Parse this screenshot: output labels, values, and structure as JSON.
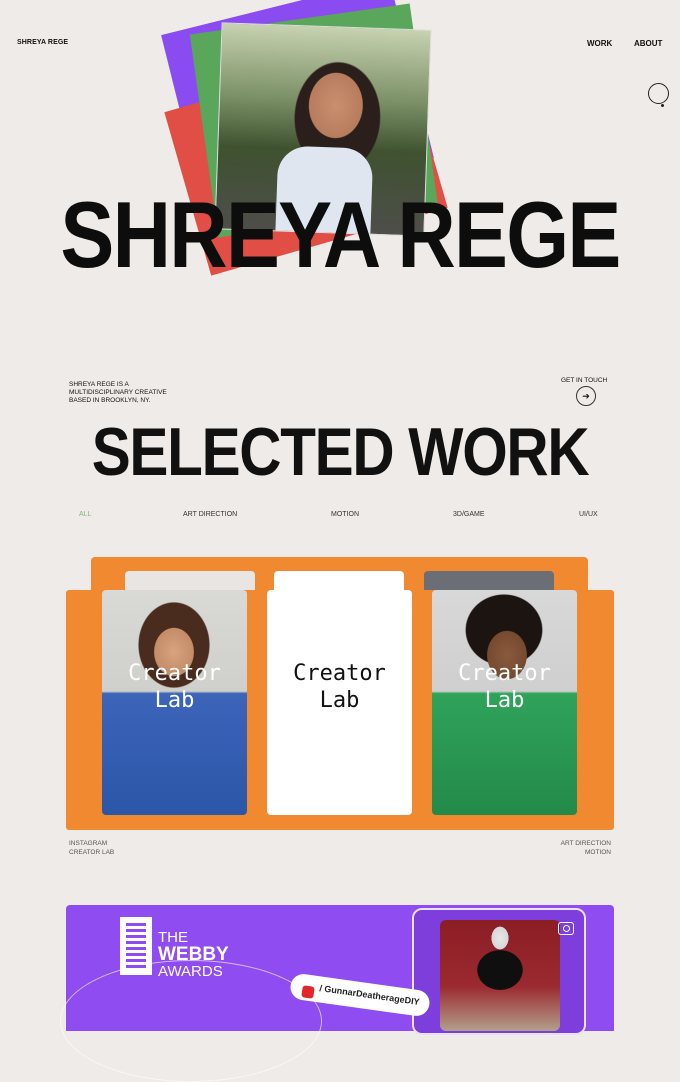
{
  "header": {
    "logo": "SHREYA REGE",
    "nav": {
      "work": "WORK",
      "about": "ABOUT"
    }
  },
  "hero": {
    "title": "SHREYA REGE",
    "card_colors": [
      "#8a4cf1",
      "#e14e45",
      "#5aa65a"
    ]
  },
  "intro": {
    "bio": "SHREYA REGE IS A MULTIDISCIPLINARY CREATIVE BASED IN BROOKLYN, NY.",
    "cta": "GET IN TOUCH",
    "cta_icon": "arrow-right-icon"
  },
  "work": {
    "title": "SELECTED WORK",
    "filters": [
      "ALL",
      "ART DIRECTION",
      "MOTION",
      "3D/GAME",
      "UI/UX"
    ],
    "active_filter": "ALL"
  },
  "projects": [
    {
      "panel_text": "Creator\nLab",
      "panel_line1": "Creator",
      "panel_line2": "Lab",
      "meta_left": [
        "INSTAGRAM",
        "CREATOR LAB"
      ],
      "meta_right": [
        "ART DIRECTION",
        "MOTION"
      ],
      "accent": "#f0892f"
    },
    {
      "logo_line1": "THE",
      "logo_line2": "WEBBY",
      "logo_line3": "AWARDS",
      "tag": "/ GunnarDeatherageDIY",
      "accent": "#8f4cf0",
      "camera_icon": "camera-icon"
    }
  ]
}
